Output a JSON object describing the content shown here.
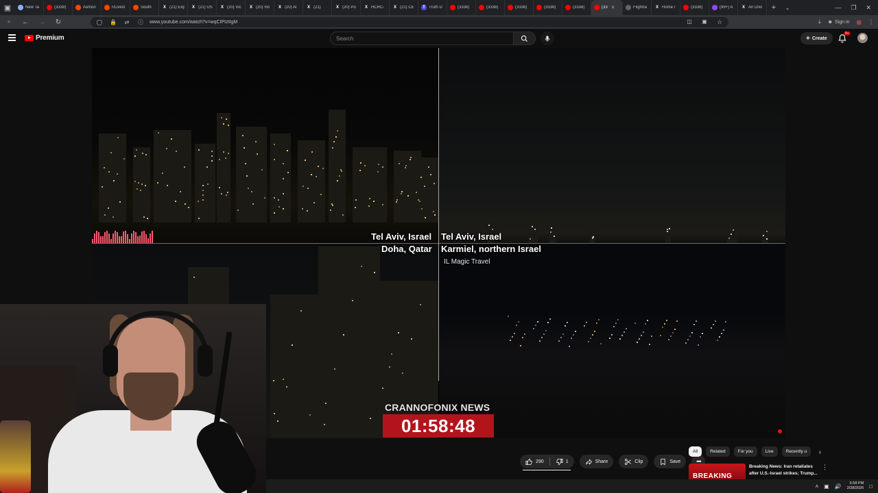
{
  "browser": {
    "tabs": [
      {
        "label": "New Ta",
        "icon": "newtab-icon",
        "color": "#8ab4f8",
        "glyph": ""
      },
      {
        "label": "(3338)",
        "icon": "youtube-icon",
        "color": "#ff0000",
        "glyph": ""
      },
      {
        "label": "Asmon",
        "icon": "reddit-icon",
        "color": "#ff4500",
        "glyph": ""
      },
      {
        "label": "r/Livest",
        "icon": "reddit-icon",
        "color": "#ff4500",
        "glyph": ""
      },
      {
        "label": "South",
        "icon": "reddit-icon",
        "color": "#ff4500",
        "glyph": ""
      },
      {
        "label": "(21) Exp",
        "icon": "x-icon",
        "color": "#202124",
        "glyph": "X"
      },
      {
        "label": "(21) US",
        "icon": "x-icon",
        "color": "#202124",
        "glyph": "X"
      },
      {
        "label": "(20) Vic",
        "icon": "x-icon",
        "color": "#202124",
        "glyph": "X"
      },
      {
        "label": "(20) Ho",
        "icon": "x-icon",
        "color": "#202124",
        "glyph": "X"
      },
      {
        "label": "(20) Al",
        "icon": "x-icon",
        "color": "#202124",
        "glyph": "X"
      },
      {
        "label": "(21)",
        "icon": "x-icon",
        "color": "#202124",
        "glyph": "X"
      },
      {
        "label": "(20) Po",
        "icon": "x-icon",
        "color": "#202124",
        "glyph": "X"
      },
      {
        "label": "HCRC-",
        "icon": "x-icon",
        "color": "#202124",
        "glyph": "X"
      },
      {
        "label": "(21) CE",
        "icon": "x-icon",
        "color": "#202124",
        "glyph": "X"
      },
      {
        "label": "Truth D",
        "icon": "truth-social-icon",
        "color": "#5448ee",
        "glyph": "T"
      },
      {
        "label": "(3338)",
        "icon": "youtube-icon",
        "color": "#ff0000",
        "glyph": ""
      },
      {
        "label": "(3338)",
        "icon": "youtube-icon",
        "color": "#ff0000",
        "glyph": ""
      },
      {
        "label": "(3338)",
        "icon": "youtube-icon",
        "color": "#ff0000",
        "glyph": ""
      },
      {
        "label": "(3338)",
        "icon": "youtube-icon",
        "color": "#ff0000",
        "glyph": ""
      },
      {
        "label": "(3338)",
        "icon": "youtube-icon",
        "color": "#ff0000",
        "glyph": ""
      },
      {
        "label": "(33",
        "icon": "youtube-icon",
        "color": "#ff0000",
        "glyph": "",
        "active": true
      },
      {
        "label": "Flightra",
        "icon": "globe-icon",
        "color": "#5f6368",
        "glyph": ""
      },
      {
        "label": "Home /",
        "icon": "x-icon",
        "color": "#202124",
        "glyph": "X"
      },
      {
        "label": "(3338)",
        "icon": "youtube-icon",
        "color": "#ff0000",
        "glyph": ""
      },
      {
        "label": "(99+) A",
        "icon": "twitch-icon",
        "color": "#9146ff",
        "glyph": ""
      },
      {
        "label": "Ari Drei",
        "icon": "x-icon",
        "color": "#202124",
        "glyph": "X"
      }
    ],
    "url": "www.youtube.com/watch?v=wqCIPIztIgM",
    "signin_label": "Sign in"
  },
  "youtube": {
    "logo_text": "Premium",
    "search_placeholder": "Search",
    "create_label": "Create",
    "notification_badge": "9+"
  },
  "video": {
    "labels": {
      "tl_top": "Tel Aviv, Israel",
      "tl_bottom": "Doha, Qatar",
      "tr_top": "Tel Aviv, Israel",
      "tr_bottom": "Karmiel, northern Israel",
      "tr_sub": "IL Magic Travel"
    },
    "news_brand": "CRANNOFONIX NEWS",
    "news_clock": "01:58:48"
  },
  "actions": {
    "likes": "290",
    "dislikes": "1",
    "share": "Share",
    "clip": "Clip",
    "save": "Save"
  },
  "chips": [
    "All",
    "Related",
    "For you",
    "Live",
    "Recently u"
  ],
  "related": {
    "thumb_text": "BREAKING",
    "title": "Breaking News: Iran retaliates after U.S.-Israel strikes; Trump..."
  },
  "taskbar": {
    "time": "5:58 PM",
    "date": "2/28/2026"
  }
}
